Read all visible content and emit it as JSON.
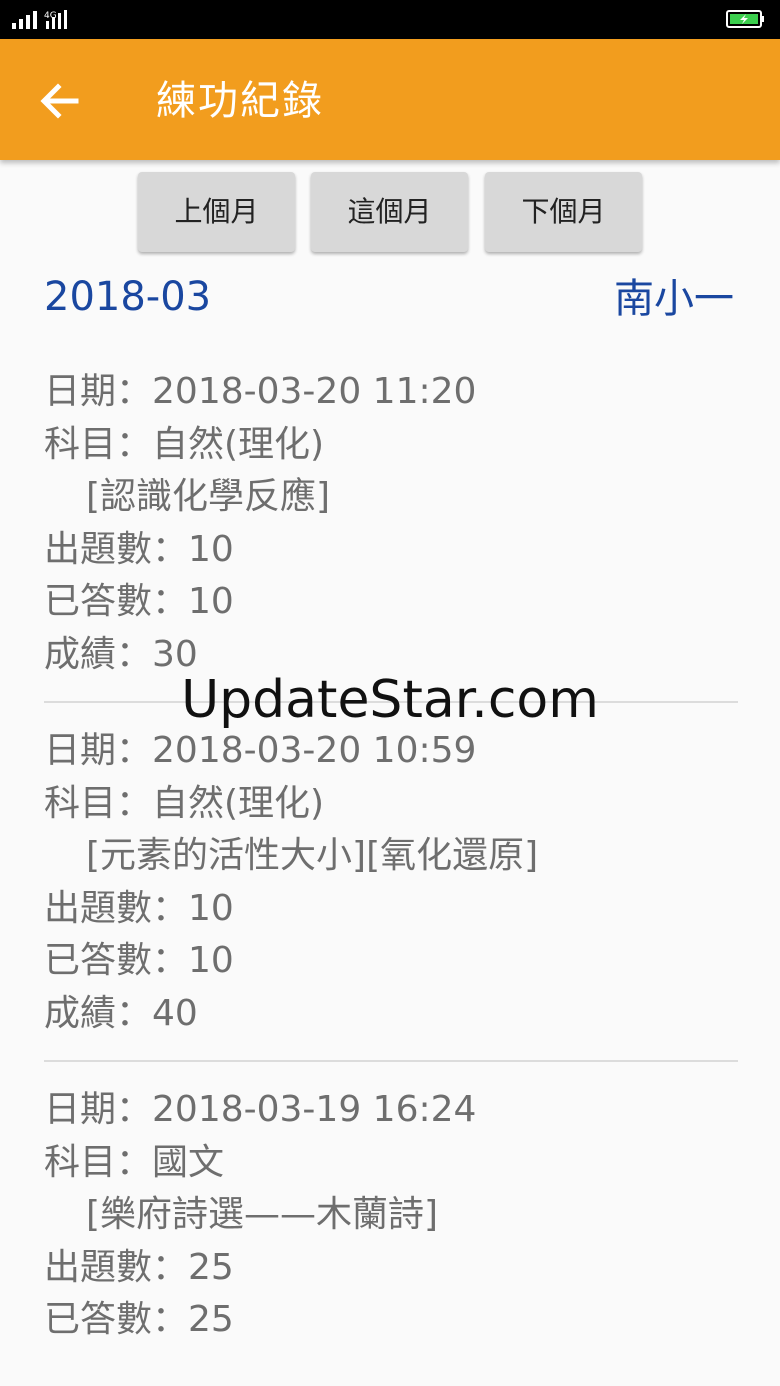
{
  "app_bar": {
    "title": "練功紀錄"
  },
  "nav_buttons": {
    "prev": "上個月",
    "current": "這個月",
    "next": "下個月"
  },
  "month": "2018-03",
  "student": "南小一",
  "records": [
    {
      "date_label": "日期：",
      "date": "2018-03-20 11:20",
      "subject_label": "科目：",
      "subject": "自然(理化)",
      "topic": "[認識化學反應]",
      "questions_label": "出題數：",
      "questions": "10",
      "answered_label": "已答數：",
      "answered": "10",
      "score_label": "成績：",
      "score": "30"
    },
    {
      "date_label": "日期：",
      "date": "2018-03-20 10:59",
      "subject_label": "科目：",
      "subject": "自然(理化)",
      "topic": "[元素的活性大小][氧化還原]",
      "questions_label": "出題數：",
      "questions": "10",
      "answered_label": "已答數：",
      "answered": "10",
      "score_label": "成績：",
      "score": "40"
    },
    {
      "date_label": "日期：",
      "date": "2018-03-19 16:24",
      "subject_label": "科目：",
      "subject": "國文",
      "topic": "[樂府詩選——木蘭詩]",
      "questions_label": "出題數：",
      "questions": "25",
      "answered_label": "已答數：",
      "answered": "25"
    }
  ],
  "watermark": "UpdateStar.com",
  "colors": {
    "app_bar": "#f29d1e",
    "accent_text": "#1a47a0",
    "record_text": "#6e6e6e"
  },
  "icons": {
    "back": "arrow-left-icon",
    "signal": "signal-icon",
    "battery": "battery-charging-icon"
  }
}
